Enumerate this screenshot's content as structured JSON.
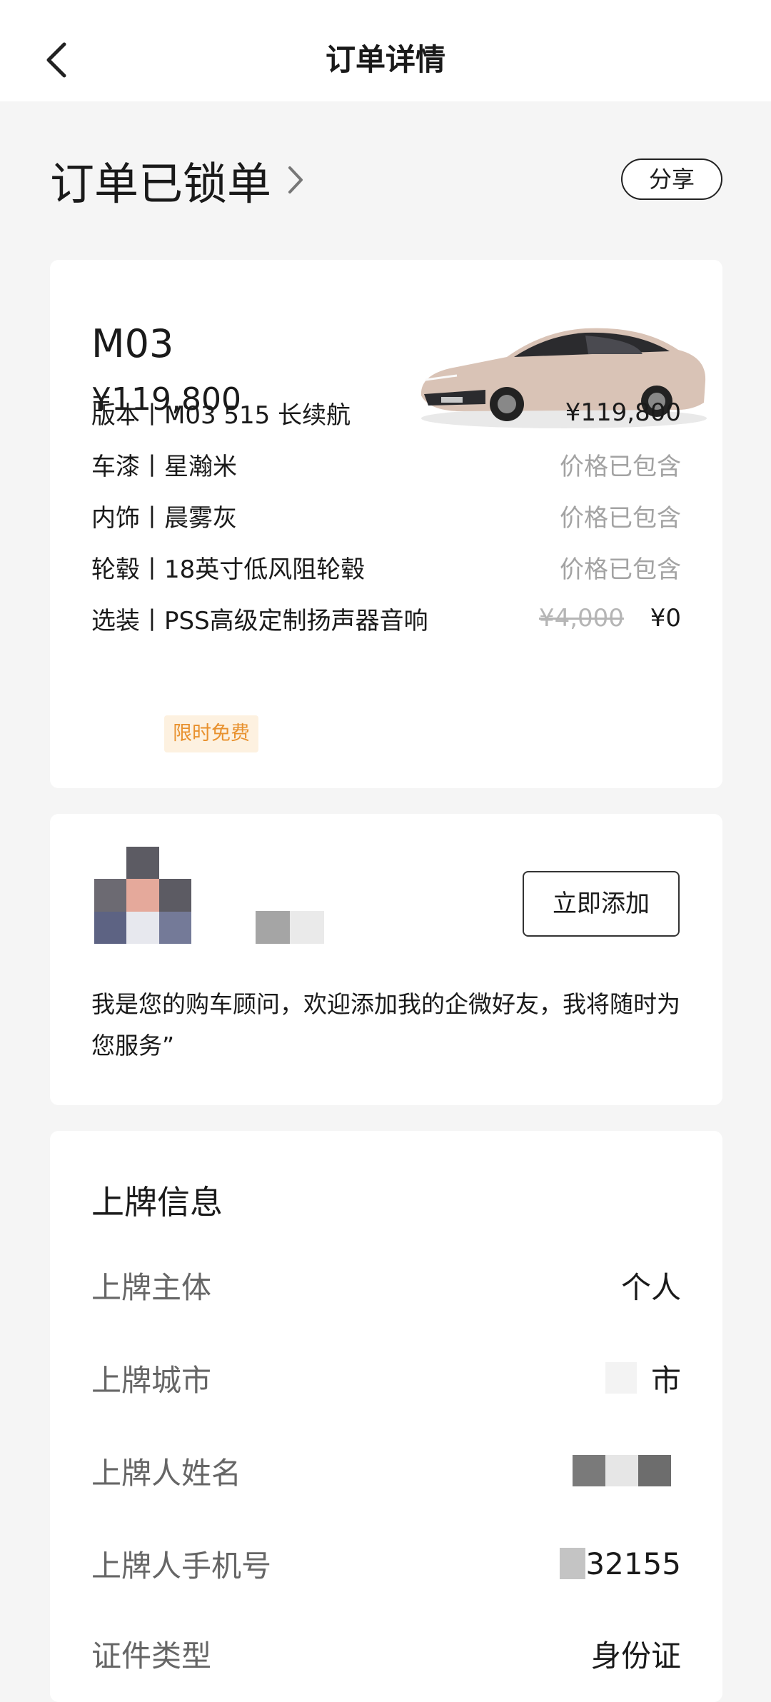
{
  "header": {
    "title": "订单详情",
    "back_icon": "chevron-left-icon"
  },
  "status": {
    "title": "订单已锁单",
    "share_label": "分享"
  },
  "car": {
    "model": "M03",
    "price": "¥119,800",
    "image_colors": {
      "body": "#d9c3b6",
      "roof": "#2b2b2e"
    },
    "specs": [
      {
        "label": "版本丨M03 515 长续航",
        "value": "¥119,800"
      },
      {
        "label": "车漆丨星瀚米",
        "value": "价格已包含"
      },
      {
        "label": "内饰丨晨雾灰",
        "value": "价格已包含"
      },
      {
        "label": "轮毂丨18英寸低风阻轮毂",
        "value": "价格已包含"
      },
      {
        "label": "选装丨PSS高级定制扬声器音响",
        "original_value": "¥4,000",
        "value": "¥0",
        "badge": "限时免费"
      }
    ]
  },
  "advisor": {
    "add_label": "立即添加",
    "message": "我是您的购车顾问，欢迎添加我的企微好友，我将随时为您服务”"
  },
  "plate_info": {
    "title": "上牌信息",
    "rows": [
      {
        "label": "上牌主体",
        "value": "个人"
      },
      {
        "label": "上牌城市",
        "value": "市"
      },
      {
        "label": "上牌人姓名",
        "value": ""
      },
      {
        "label": "上牌人手机号",
        "value": "32155"
      },
      {
        "label": "证件类型",
        "value": "身份证"
      }
    ]
  },
  "colors": {
    "accent": "#e8912e",
    "badge_bg": "#fdf1e0",
    "muted": "#a3a3a3",
    "background": "#f5f5f5"
  }
}
